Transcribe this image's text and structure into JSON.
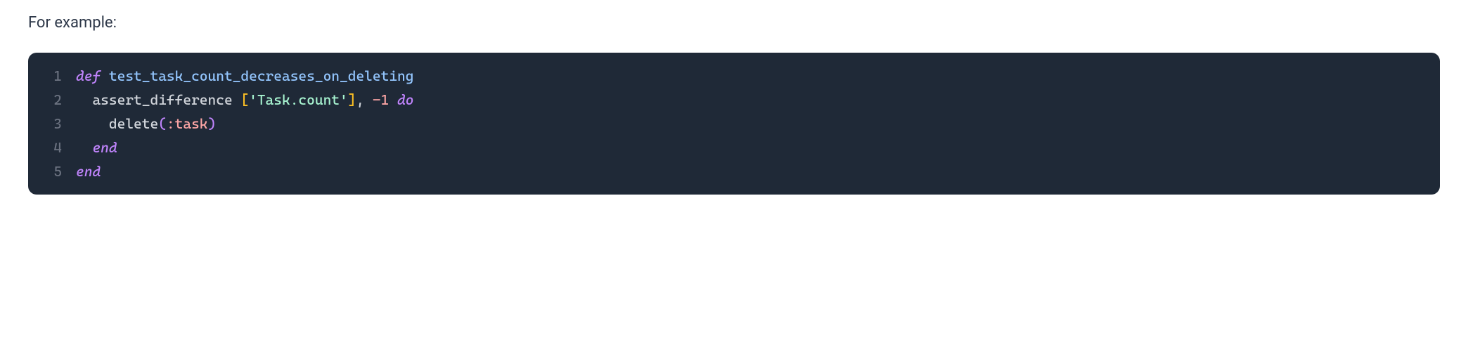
{
  "intro": "For example:",
  "code": {
    "lines": [
      {
        "num": "1",
        "tokens": [
          {
            "cls": "kw-def",
            "text": "def"
          },
          {
            "cls": "plain",
            "text": " "
          },
          {
            "cls": "method-name",
            "text": "test_task_count_decreases_on_deleting"
          }
        ]
      },
      {
        "num": "2",
        "tokens": [
          {
            "cls": "plain",
            "text": "  assert_difference "
          },
          {
            "cls": "bracket",
            "text": "["
          },
          {
            "cls": "string",
            "text": "'Task.count'"
          },
          {
            "cls": "bracket",
            "text": "]"
          },
          {
            "cls": "plain",
            "text": ", "
          },
          {
            "cls": "number",
            "text": "-1"
          },
          {
            "cls": "plain",
            "text": " "
          },
          {
            "cls": "kw-do",
            "text": "do"
          }
        ]
      },
      {
        "num": "3",
        "tokens": [
          {
            "cls": "plain",
            "text": "    delete"
          },
          {
            "cls": "paren",
            "text": "("
          },
          {
            "cls": "symbol",
            "text": ":task"
          },
          {
            "cls": "paren",
            "text": ")"
          }
        ]
      },
      {
        "num": "4",
        "tokens": [
          {
            "cls": "plain",
            "text": "  "
          },
          {
            "cls": "kw-end",
            "text": "end"
          }
        ]
      },
      {
        "num": "5",
        "tokens": [
          {
            "cls": "kw-end",
            "text": "end"
          }
        ]
      }
    ]
  }
}
